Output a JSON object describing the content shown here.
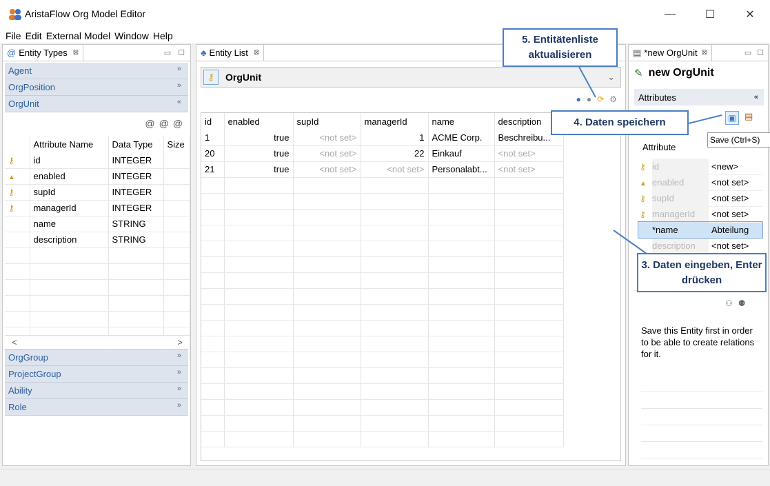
{
  "window": {
    "title": "AristaFlow Org Model Editor",
    "minimize": "—",
    "maximize": "☐",
    "close": "✕"
  },
  "menu": [
    "File",
    "Edit",
    "External Model",
    "Window",
    "Help"
  ],
  "entity_types_view": {
    "tab_label": "Entity Types",
    "categories_top": [
      "Agent",
      "OrgPosition"
    ],
    "expanded_category": "OrgUnit",
    "categories_bottom": [
      "OrgGroup",
      "ProjectGroup",
      "Ability",
      "Role"
    ],
    "columns": [
      "Attribute Name",
      "Data Type",
      "Size"
    ],
    "attributes": [
      {
        "name": "id",
        "type": "INTEGER",
        "icon": "key-icon"
      },
      {
        "name": "enabled",
        "type": "INTEGER",
        "icon": "lock-icon"
      },
      {
        "name": "supId",
        "type": "INTEGER",
        "icon": "key-icon"
      },
      {
        "name": "managerId",
        "type": "INTEGER",
        "icon": "key-icon"
      },
      {
        "name": "name",
        "type": "STRING",
        "icon": ""
      },
      {
        "name": "description",
        "type": "STRING",
        "icon": ""
      }
    ],
    "scroll_left": "<",
    "scroll_right": ">"
  },
  "entity_list_view": {
    "tab_label": "Entity List",
    "entity_type": "OrgUnit",
    "columns": [
      "id",
      "enabled",
      "supId",
      "managerId",
      "name",
      "description"
    ],
    "rows": [
      {
        "id": "1",
        "enabled": "true",
        "supId": "<not set>",
        "managerId": "1",
        "name": "ACME Corp.",
        "description": "Beschreibu..."
      },
      {
        "id": "20",
        "enabled": "true",
        "supId": "<not set>",
        "managerId": "22",
        "name": "Einkauf",
        "description": "<not set>"
      },
      {
        "id": "21",
        "enabled": "true",
        "supId": "<not set>",
        "managerId": "<not set>",
        "name": "Personalabt...",
        "description": "<not set>"
      }
    ]
  },
  "editor_view": {
    "tab_label": "*new OrgUnit",
    "title": "new OrgUnit",
    "attributes_section": "Attributes",
    "attr_col": "Attribute",
    "attributes": [
      {
        "name": "id",
        "value": "<new>",
        "icon": "key-icon"
      },
      {
        "name": "enabled",
        "value": "<not set>",
        "icon": "lock-icon"
      },
      {
        "name": "supId",
        "value": "<not set>",
        "icon": "key-icon"
      },
      {
        "name": "managerId",
        "value": "<not set>",
        "icon": "key-icon"
      },
      {
        "name": "*name",
        "value": "Abteilung",
        "icon": ""
      },
      {
        "name": "description",
        "value": "<not set>",
        "icon": ""
      }
    ],
    "save_tooltip": "Save (Ctrl+S)",
    "relations_note": "Save this Entity first in order to be able to create relations for it."
  },
  "callouts": {
    "refresh": "5. Entitätenliste aktualisieren",
    "save": "4. Daten speichern",
    "enter": "3. Daten eingeben, Enter drücken"
  },
  "colors": {
    "callout_border": "#4a80c1",
    "callout_text": "#1f3864",
    "category_bg": "#dde4ee",
    "category_text": "#2b5d9c",
    "selection": "#cfe3f7"
  }
}
